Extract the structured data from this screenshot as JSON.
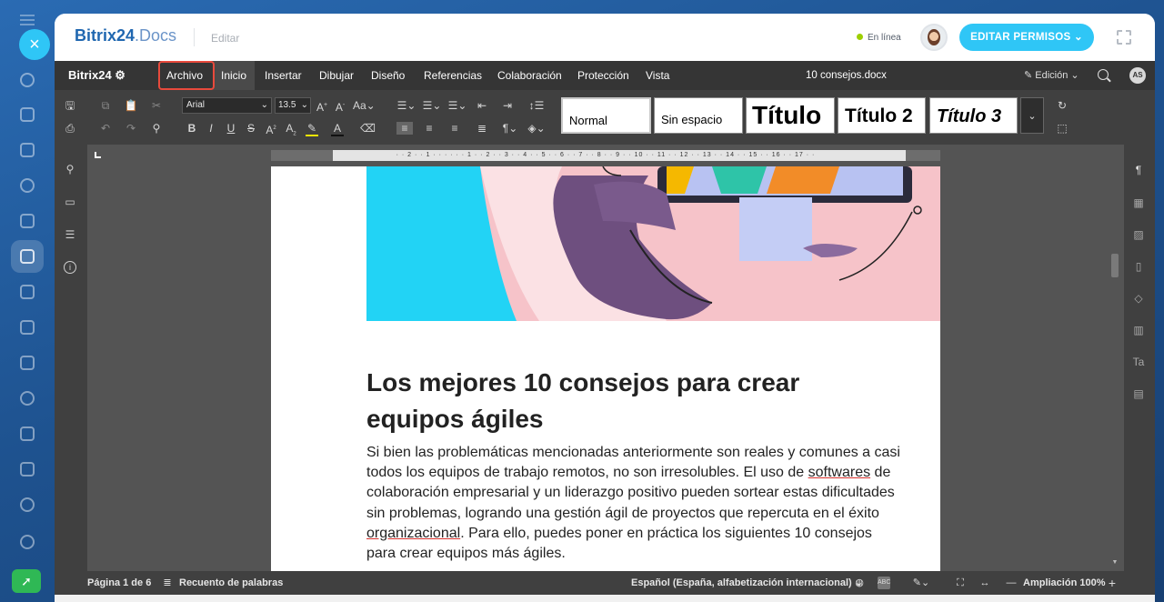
{
  "app": {
    "logo_b24": "Bitrix24",
    "logo_docs": ".Docs",
    "edit_label": "Editar",
    "online_status": "En línea",
    "permissions_button": "EDITAR PERMISOS ⌄"
  },
  "menubar": {
    "logo": "Bitrix24 ⚙",
    "items": [
      "Archivo",
      "Inicio",
      "Insertar",
      "Dibujar",
      "Diseño",
      "Referencias",
      "Colaboración",
      "Protección",
      "Vista"
    ],
    "active_item": "Inicio",
    "highlighted_item": "Archivo",
    "document_title": "10 consejos.docx",
    "mode": "Edición",
    "user_initials": "AS"
  },
  "toolbar": {
    "font_name": "Arial",
    "font_size": "13.5",
    "styles": [
      "Normal",
      "Sin espacio",
      "Título",
      "Título 2",
      "Título 3"
    ]
  },
  "ruler": {
    "labels": "· · 2 · · 1 · · · · · · 1 · · 2 · · 3 · · 4 · · 5 · · 6 · · 7 · · 8 · · 9 · · 10 · · 11 · · 12 · · 13 · · 14 · · 15 · · 16 · · 17 · ·"
  },
  "document": {
    "heading": "Los mejores 10 consejos para crear equipos ágiles",
    "body_1": "Si bien las problemáticas mencionadas anteriormente son reales y comunes a casi todos los equipos de trabajo remotos, no son irresolubles. El uso de ",
    "body_spell_1": "softwares",
    "body_2": " de colaboración empresarial y un liderazgo positivo pueden sortear estas dificultades sin problemas, logrando una gestión ágil de proyectos que repercuta en el éxito ",
    "body_spell_2": "organizacional",
    "body_3": ". Para ello, puedes poner en práctica los siguientes 10 consejos para crear equipos más ágiles."
  },
  "statusbar": {
    "page": "Página 1 de 6",
    "word_count": "Recuento de palabras",
    "language": "Español (España, alfabetización internacional) ⌄",
    "zoom": "Ampliación 100%"
  },
  "colors": {
    "accent": "#2fc6f6",
    "brand_blue": "#2067b0",
    "highlight_border": "#e84a3c",
    "menubar_bg": "#353535",
    "toolbar_bg": "#404040",
    "online_dot": "#9dcf00"
  }
}
